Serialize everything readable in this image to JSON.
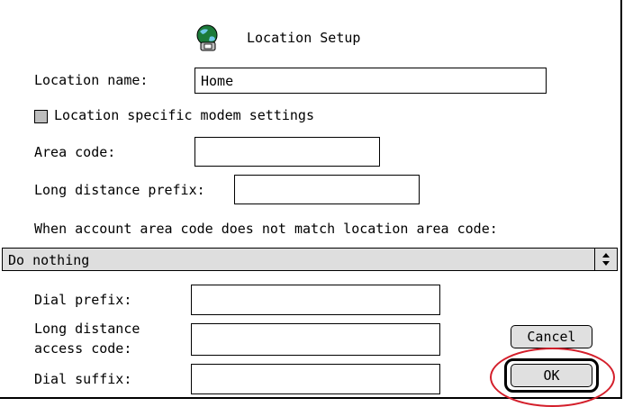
{
  "window": {
    "title": "Location Setup",
    "icon": "globe-phone-icon"
  },
  "location_name": {
    "label": "Location name:",
    "value": "Home"
  },
  "modem_settings": {
    "label": "Location specific modem settings",
    "checked": false
  },
  "area_code": {
    "label": "Area code:",
    "value": ""
  },
  "long_distance_prefix": {
    "label": "Long distance prefix:",
    "value": ""
  },
  "mismatch": {
    "label": "When account area code does not match location area code:",
    "selected": "Do nothing"
  },
  "dial_prefix": {
    "label": "Dial prefix:",
    "value": ""
  },
  "long_distance_access": {
    "label_line1": "Long distance",
    "label_line2": "access code:",
    "value": ""
  },
  "dial_suffix": {
    "label": "Dial suffix:",
    "value": ""
  },
  "buttons": {
    "cancel": "Cancel",
    "ok": "OK"
  },
  "colors": {
    "highlight": "#d41f2b",
    "control_gray": "#dedede"
  }
}
